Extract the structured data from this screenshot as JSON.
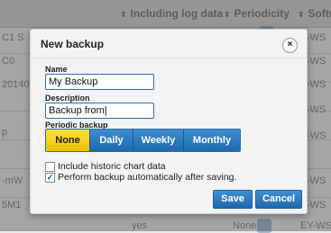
{
  "background": {
    "columns": [
      {
        "label": "Including log data"
      },
      {
        "label": "Periodicity"
      },
      {
        "label": "Softw"
      }
    ],
    "left_fragments": [
      "C1 S",
      "C0",
      "20140",
      "p",
      "-mW",
      "5M1"
    ],
    "right_fragments": [
      "-WS",
      "-WS",
      "-WS",
      "-WS",
      "-WS",
      "-WS",
      "-WS",
      "EY-WS"
    ],
    "bottom": {
      "yes": "yes",
      "none": "None"
    }
  },
  "dialog": {
    "title": "New backup",
    "close_symbol": "×",
    "name": {
      "label": "Name",
      "value": "My Backup"
    },
    "description": {
      "label": "Description",
      "value": "Backup from"
    },
    "periodic": {
      "label": "Periodic backup",
      "options": [
        "None",
        "Daily",
        "Weekly",
        "Monthly"
      ],
      "selected": "None"
    },
    "checkboxes": [
      {
        "label": "Include historic chart data",
        "checked": false
      },
      {
        "label": "Perform backup automatically after saving.",
        "checked": true
      }
    ],
    "buttons": {
      "save": "Save",
      "cancel": "Cancel"
    }
  },
  "colors": {
    "accent": "#2a78bd",
    "selected": "#ffd21a"
  }
}
